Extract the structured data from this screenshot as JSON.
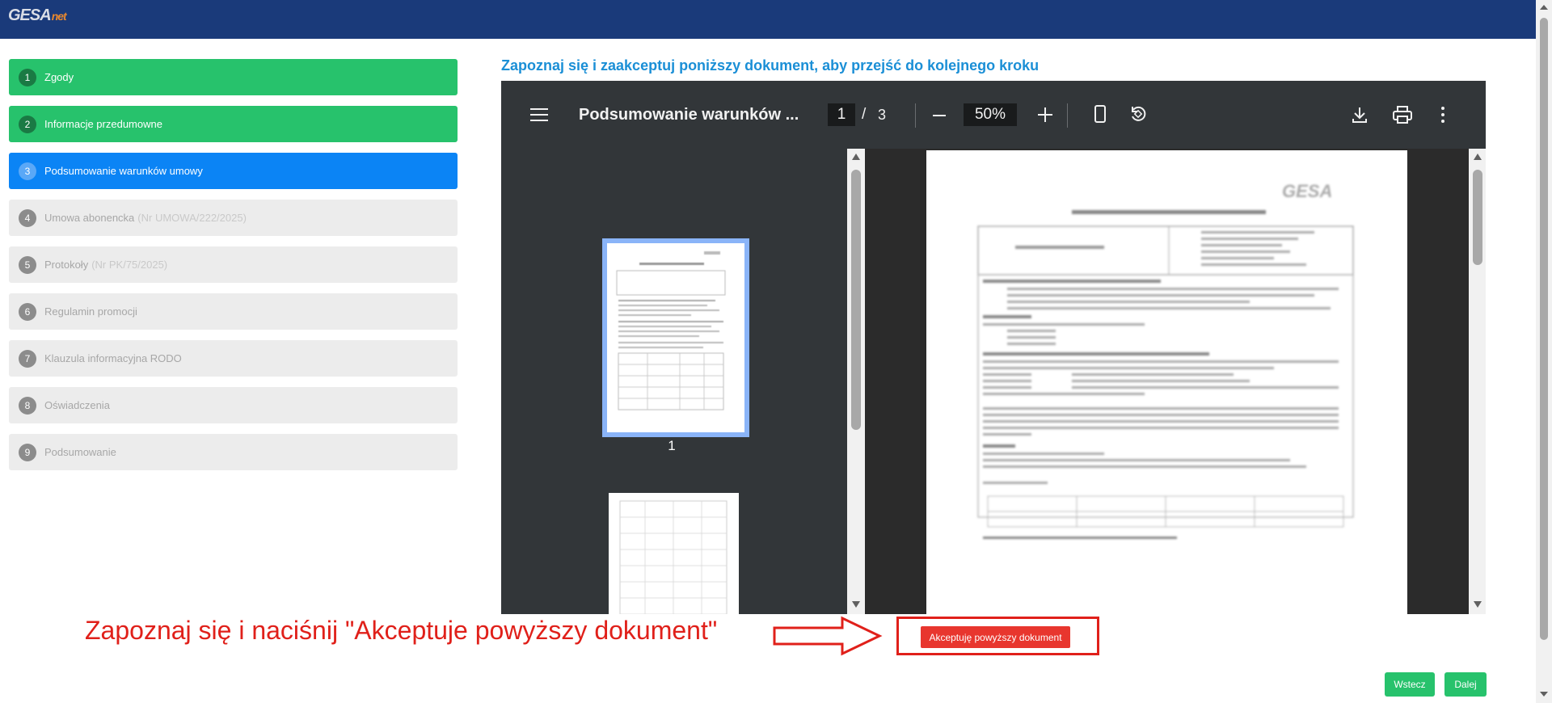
{
  "app": {
    "logo_main": "GESA",
    "logo_suffix": "net"
  },
  "steps": [
    {
      "num": "1",
      "label": "Zgody",
      "sub": "",
      "state": "done"
    },
    {
      "num": "2",
      "label": "Informacje przedumowne",
      "sub": "",
      "state": "done"
    },
    {
      "num": "3",
      "label": "Podsumowanie warunków umowy",
      "sub": "",
      "state": "active"
    },
    {
      "num": "4",
      "label": "Umowa abonencka",
      "sub": "(Nr UMOWA/222/2025)",
      "state": "todo"
    },
    {
      "num": "5",
      "label": "Protokoły",
      "sub": "(Nr PK/75/2025)",
      "state": "todo"
    },
    {
      "num": "6",
      "label": "Regulamin promocji",
      "sub": "",
      "state": "todo"
    },
    {
      "num": "7",
      "label": "Klauzula informacyjna RODO",
      "sub": "",
      "state": "todo"
    },
    {
      "num": "8",
      "label": "Oświadczenia",
      "sub": "",
      "state": "todo"
    },
    {
      "num": "9",
      "label": "Podsumowanie",
      "sub": "",
      "state": "todo"
    }
  ],
  "heading": "Zapoznaj się i zaakceptuj poniższy dokument, aby przejść do kolejnego kroku",
  "viewer": {
    "title": "Podsumowanie warunków ...",
    "current_page": "1",
    "separator": "/",
    "total_pages": "3",
    "zoom": "50%",
    "thumb1_label": "1",
    "icons": [
      "menu-icon",
      "zoom-out-icon",
      "zoom-in-icon",
      "fit-page-icon",
      "rotate-icon",
      "download-icon",
      "print-icon",
      "more-icon"
    ]
  },
  "instruction": "Zapoznaj się i naciśnij \"Akceptuje powyższy dokument\"",
  "accept_button": "Akceptuję powyższy dokument",
  "nav": {
    "back": "Wstecz",
    "next": "Dalej"
  },
  "colors": {
    "header": "#1a3a7a",
    "done": "#27c26c",
    "active": "#0b84f5",
    "todo": "#ececec",
    "heading": "#1b8fd6",
    "alert": "#e0201a"
  }
}
